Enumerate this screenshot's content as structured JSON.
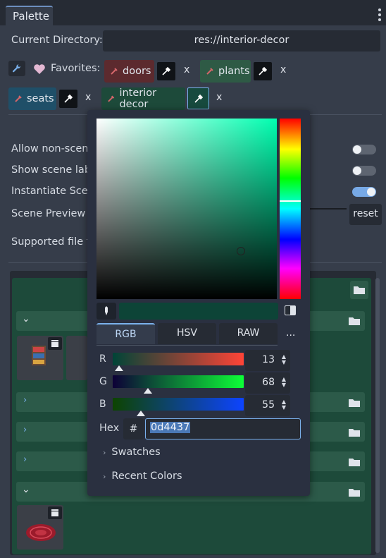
{
  "tab": {
    "label": "Palette"
  },
  "directory": {
    "label": "Current Directory:",
    "value": "res://interior-decor"
  },
  "favorites": {
    "label": "Favorites:",
    "items": [
      {
        "name": "doors",
        "color": "#5c2a2e",
        "remove": "x"
      },
      {
        "name": "plants",
        "color": "#2e5a45",
        "remove": "x"
      },
      {
        "name": "seats",
        "color": "#1f4f68",
        "remove": "x"
      },
      {
        "name": "interior decor",
        "color": "#1d4a3a",
        "remove": "x"
      }
    ]
  },
  "settings": {
    "allow_non_scene": "Allow non-scene",
    "show_scene_labels": "Show scene labe",
    "instantiate_scene": "Instantiate Scene",
    "scene_preview": "Scene Preview Sc",
    "supported_file_types": "Supported file ty",
    "reset": "reset",
    "toggles": {
      "allow_non_scene": false,
      "show_scene_labels": false,
      "instantiate_scene": true
    }
  },
  "color_picker": {
    "hex_value": "0d4437",
    "modes": [
      "RGB",
      "HSV",
      "RAW"
    ],
    "active_mode": "RGB",
    "more": "...",
    "channels": [
      {
        "label": "R",
        "value": "13",
        "fraction": 0.051
      },
      {
        "label": "G",
        "value": "68",
        "fraction": 0.267
      },
      {
        "label": "B",
        "value": "55",
        "fraction": 0.216
      }
    ],
    "hex_label": "Hex",
    "hash": "#",
    "swatches": "Swatches",
    "recent_colors": "Recent Colors",
    "accent": "#77a9e6"
  },
  "list": {
    "thumbnail_badge": "clapper-board"
  }
}
